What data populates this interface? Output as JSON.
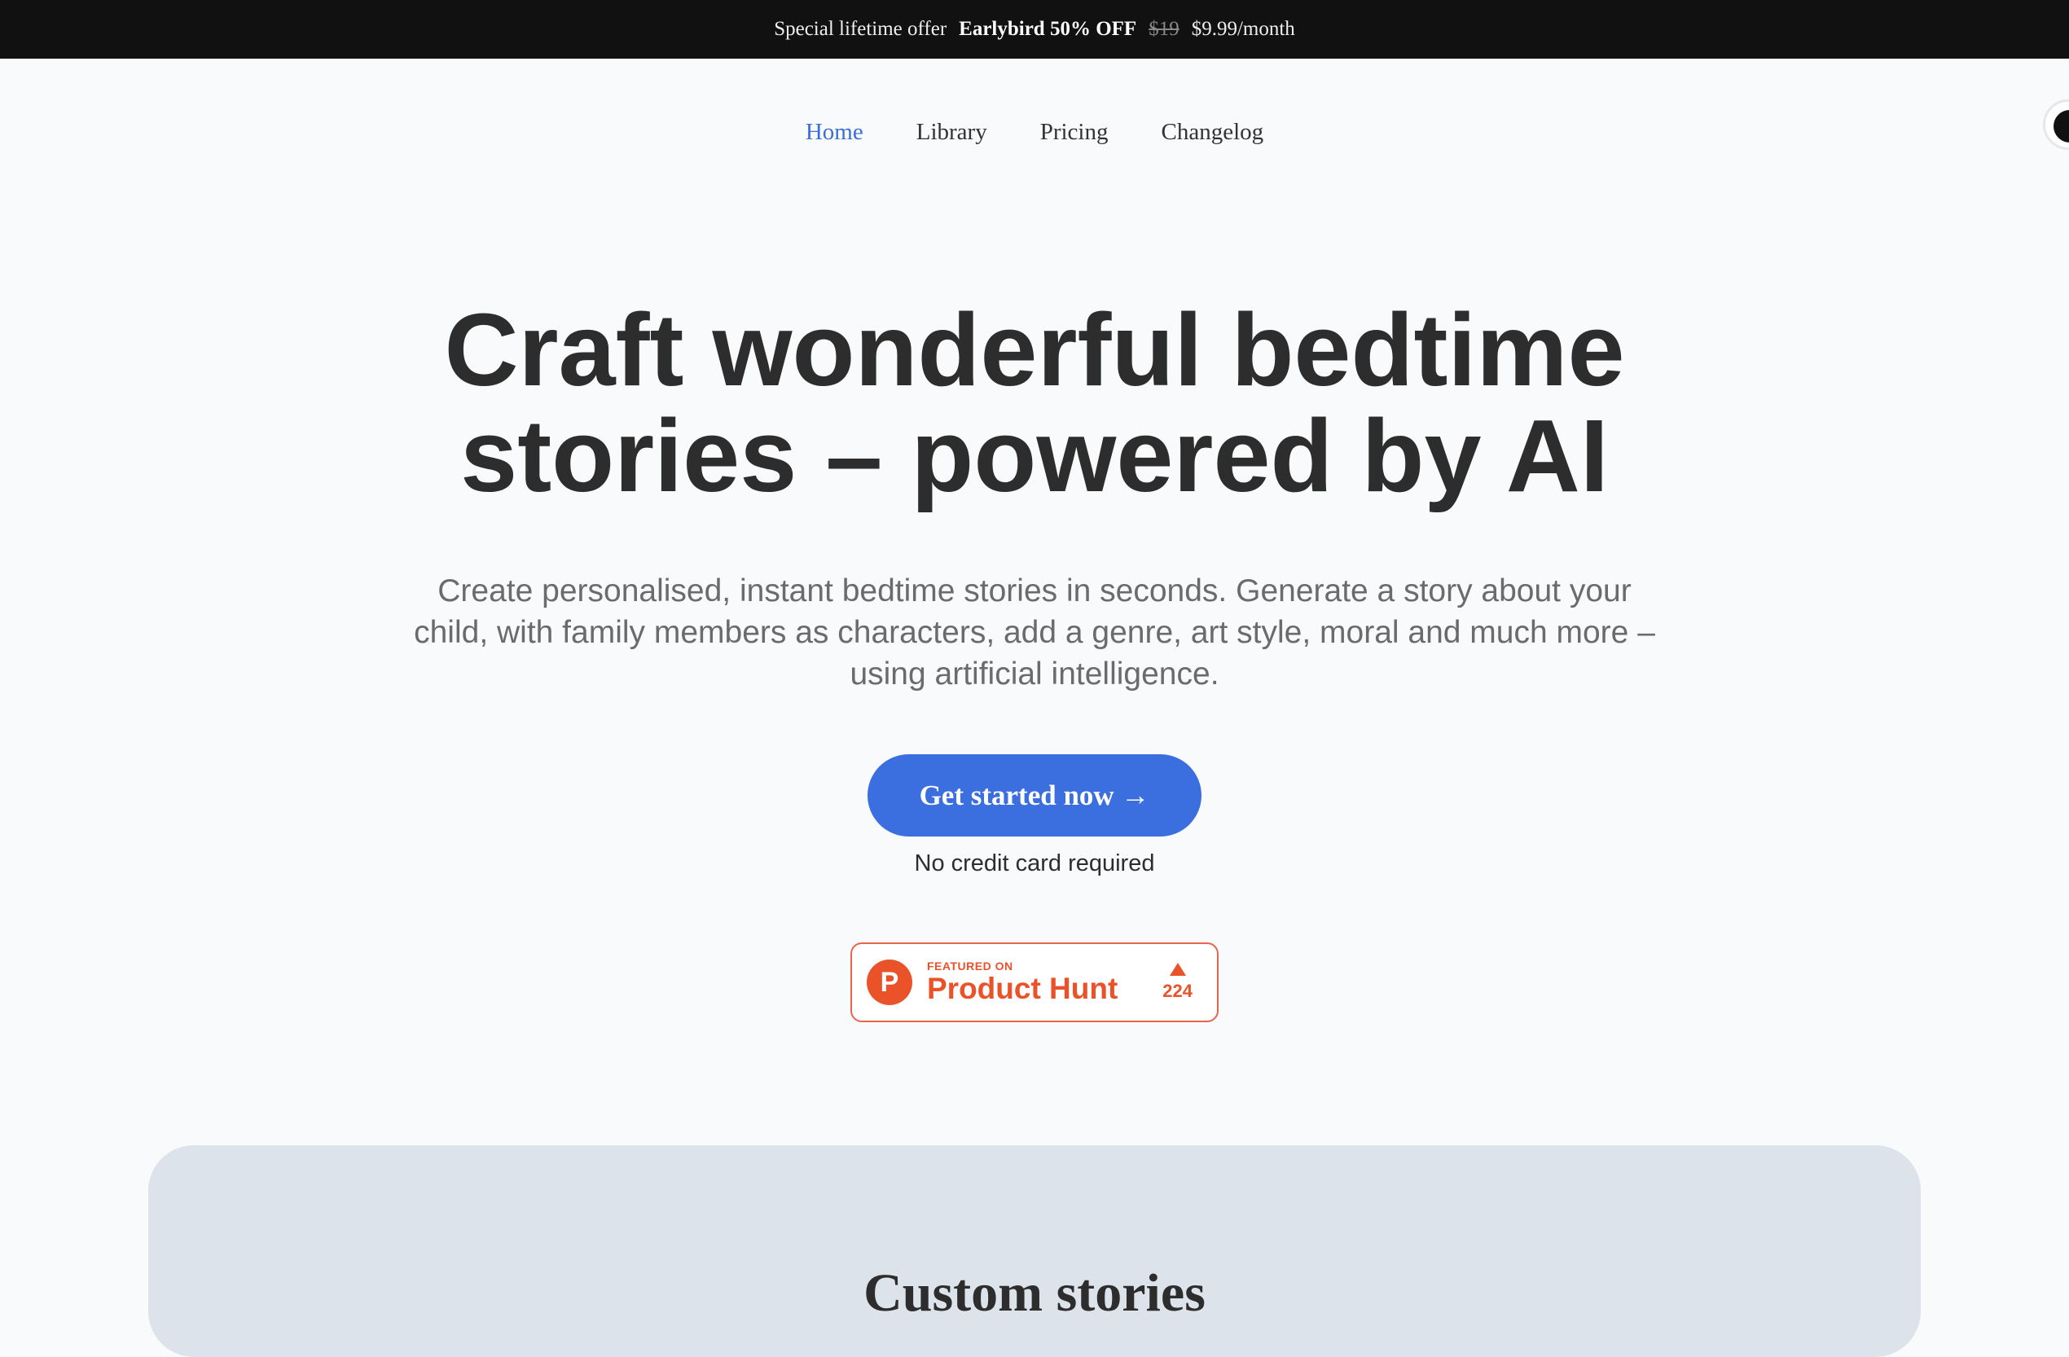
{
  "promo": {
    "lead": "Special lifetime offer",
    "highlight": "Earlybird 50% OFF",
    "old_price": "$19",
    "new_price": "$9.99/month"
  },
  "nav": {
    "items": [
      {
        "label": "Home",
        "active": true
      },
      {
        "label": "Library",
        "active": false
      },
      {
        "label": "Pricing",
        "active": false
      },
      {
        "label": "Changelog",
        "active": false
      }
    ]
  },
  "hero": {
    "title_line1": "Craft wonderful bedtime",
    "title_line2": "stories – powered by AI",
    "subtitle": "Create personalised, instant bedtime stories in seconds. Generate a story about your child, with family members as characters, add a genre, art style, moral and much more – using artificial intelligence.",
    "cta_label": "Get started now →",
    "cta_note": "No credit card required"
  },
  "product_hunt": {
    "logo_letter": "P",
    "featured_label": "FEATURED ON",
    "name": "Product Hunt",
    "votes": "224",
    "icon": "upvote-triangle-icon"
  },
  "features": {
    "title": "Custom stories"
  },
  "colors": {
    "accent": "#3b6fe0",
    "active_nav": "#3b6fd8",
    "product_hunt": "#ea532a",
    "promo_bg": "#111111",
    "card_bg": "#dce3ea"
  }
}
